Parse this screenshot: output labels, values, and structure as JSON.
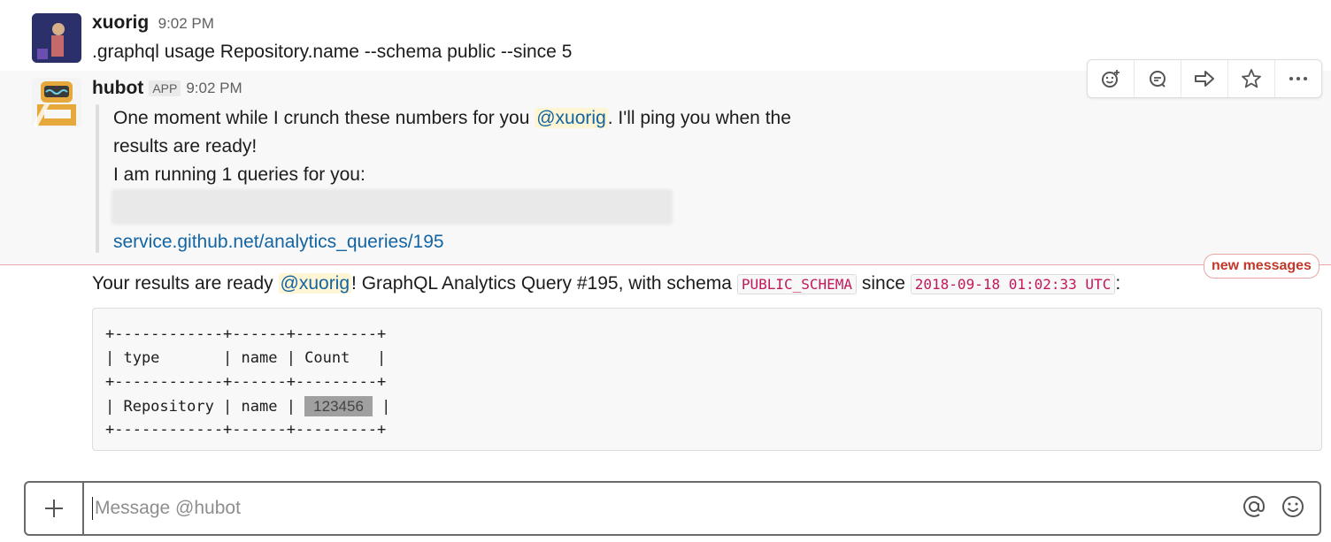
{
  "messages": [
    {
      "user": "xuorig",
      "time": "9:02 PM",
      "text": ".graphql usage Repository.name --schema public --since 5"
    },
    {
      "user": "hubot",
      "badge": "APP",
      "time": "9:02 PM",
      "line1_pre": "One moment while I crunch these numbers for you",
      "mention": "@xuorig",
      "line1_post": ". I'll ping you when the",
      "line2": "results are ready!",
      "line3": "I am running 1 queries for you:",
      "link": "service.github.net/analytics_queries/195"
    },
    {
      "text_pre": "Your results are ready",
      "mention": "@xuorig",
      "text_mid": "! GraphQL Analytics Query #195, with schema",
      "schema": "PUBLIC_SCHEMA",
      "since_label": "since",
      "since_value": "2018-09-18 01:02:33 UTC",
      "colon": ":",
      "code_lines": [
        "+------------+------+---------+",
        "| type       | name | Count   |",
        "+------------+------+---------+",
        "| Repository | name | ",
        "+------------+------+---------+"
      ],
      "row_tail": " |",
      "count_value": "123456"
    }
  ],
  "divider": {
    "label": "new messages"
  },
  "actions": [
    "add-reaction",
    "start-thread",
    "share",
    "save",
    "more"
  ],
  "composer": {
    "placeholder": "Message @hubot",
    "plus": "+"
  }
}
